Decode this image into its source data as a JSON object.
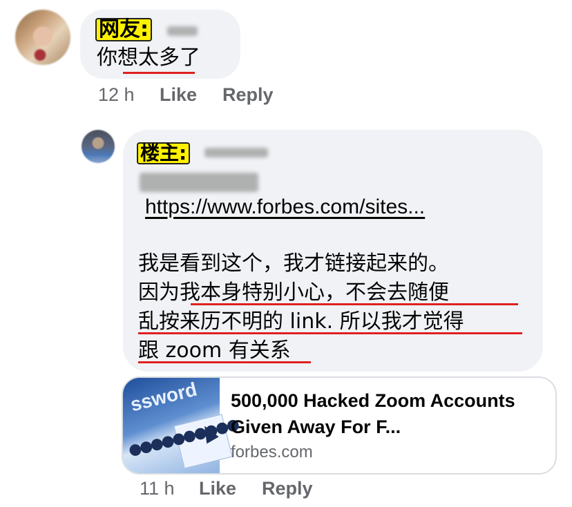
{
  "comment1": {
    "tag": "网友:",
    "text": "你想太多了",
    "time": "12 h",
    "like": "Like",
    "reply": "Reply"
  },
  "comment2": {
    "tag": "楼主:",
    "link": "https://www.forbes.com/sites...",
    "lines": [
      "我是看到这个，我才链接起来的。",
      "因为我本身特别小心，不会去随便",
      "乱按来历不明的 link. 所以我才觉得",
      "跟 zoom 有关系"
    ],
    "preview": {
      "title": "500,000 Hacked Zoom Accounts Given Away For F...",
      "domain": "forbes.com",
      "thumb_text": "ssword"
    },
    "time": "11 h",
    "like": "Like",
    "reply": "Reply"
  },
  "colors": {
    "highlight": "#fff200",
    "underline": "#e02020",
    "bubble": "#f0f2f5",
    "meta": "#65676b"
  }
}
